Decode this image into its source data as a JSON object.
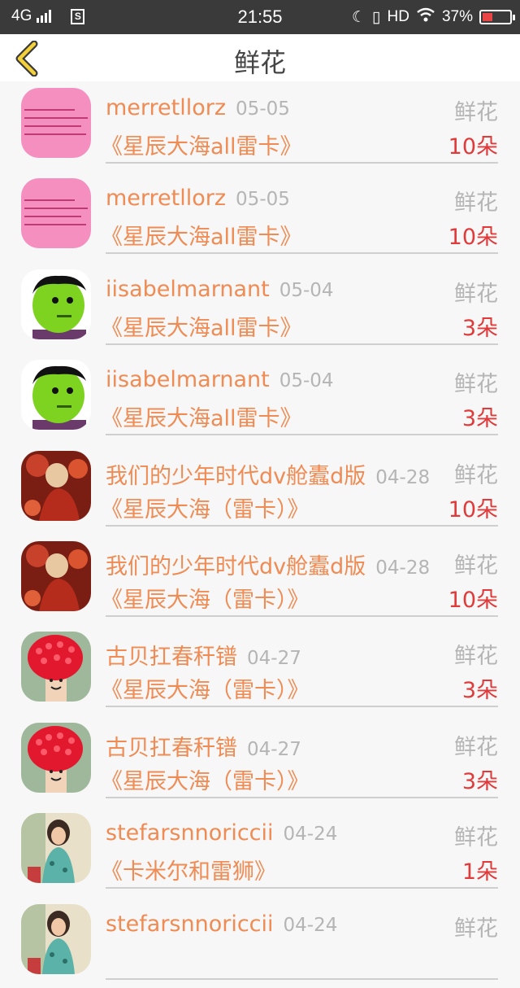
{
  "status_bar": {
    "network": "4G",
    "sim_label": "S",
    "time": "21:55",
    "hd_label": "HD",
    "battery": "37%"
  },
  "nav": {
    "title": "鲜花"
  },
  "colors": {
    "accent": "#ef8b53",
    "count": "#e03a3a",
    "muted": "#b5b5b5"
  },
  "records": [
    {
      "user": "merretllorz",
      "date": "05-05",
      "kind": "鲜花",
      "gift": "《星辰大海all雷卡》",
      "count": "10朵",
      "avatar": "pink-note"
    },
    {
      "user": "merretllorz",
      "date": "05-05",
      "kind": "鲜花",
      "gift": "《星辰大海all雷卡》",
      "count": "10朵",
      "avatar": "pink-note"
    },
    {
      "user": "iisabelmarnant",
      "date": "05-04",
      "kind": "鲜花",
      "gift": "《星辰大海all雷卡》",
      "count": "3朵",
      "avatar": "green-hulk"
    },
    {
      "user": "iisabelmarnant",
      "date": "05-04",
      "kind": "鲜花",
      "gift": "《星辰大海all雷卡》",
      "count": "3朵",
      "avatar": "green-hulk"
    },
    {
      "user": "我们的少年时代dv舱蠹d版",
      "date": "04-28",
      "kind": "鲜花",
      "gift": "《星辰大海（雷卡）》",
      "count": "10朵",
      "avatar": "red-painting"
    },
    {
      "user": "我们的少年时代dv舱蠹d版",
      "date": "04-28",
      "kind": "鲜花",
      "gift": "《星辰大海（雷卡）》",
      "count": "10朵",
      "avatar": "red-painting"
    },
    {
      "user": "古贝扛春秆镨",
      "date": "04-27",
      "kind": "鲜花",
      "gift": "《星辰大海（雷卡）》",
      "count": "3朵",
      "avatar": "raspberry"
    },
    {
      "user": "古贝扛春秆镨",
      "date": "04-27",
      "kind": "鲜花",
      "gift": "《星辰大海（雷卡）》",
      "count": "3朵",
      "avatar": "raspberry"
    },
    {
      "user": "stefarsnnoriccii",
      "date": "04-24",
      "kind": "鲜花",
      "gift": "《卡米尔和雷狮》",
      "count": "1朵",
      "avatar": "girl-photo"
    },
    {
      "user": "stefarsnnoriccii",
      "date": "04-24",
      "kind": "鲜花",
      "gift": "",
      "count": "",
      "avatar": "girl-photo"
    }
  ]
}
